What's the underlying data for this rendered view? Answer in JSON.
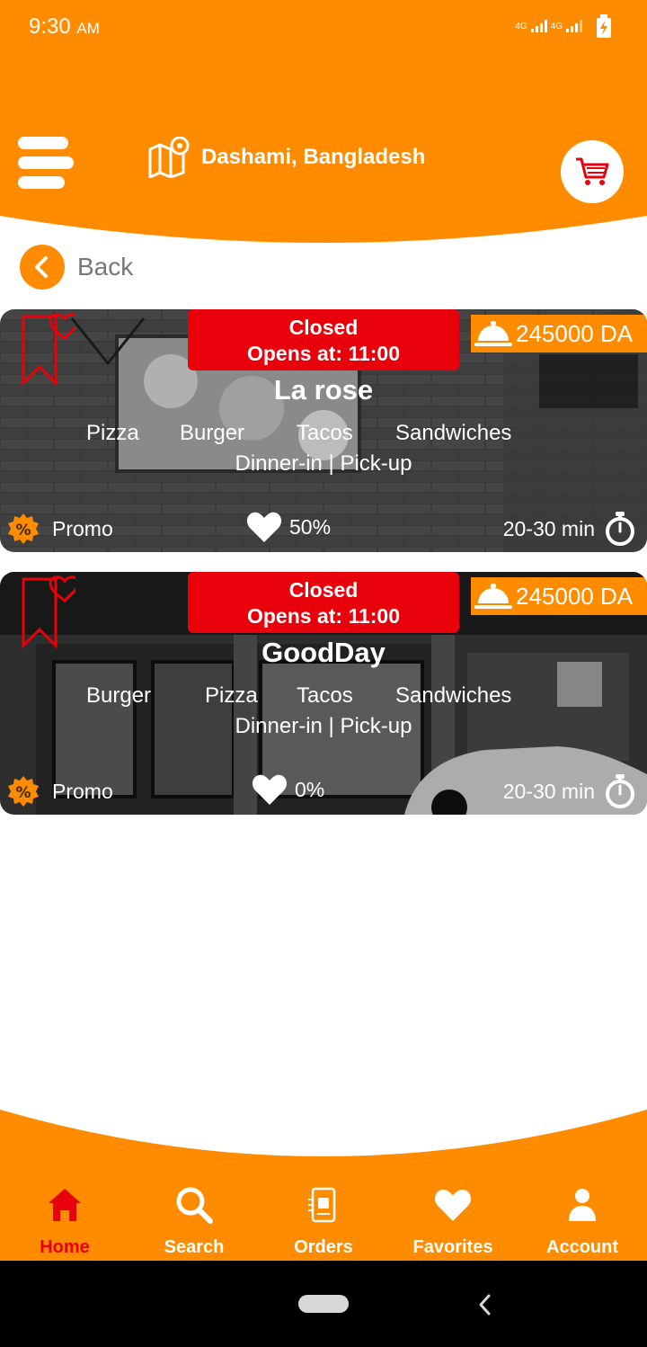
{
  "status_bar": {
    "time": "9:30",
    "ampm": "AM",
    "net1": "4G",
    "net2": "4G"
  },
  "header": {
    "location": "Dashami, Bangladesh"
  },
  "back": {
    "label": "Back"
  },
  "restaurants": [
    {
      "closed_label": "Closed",
      "opens_label": "Opens at: 11:00",
      "fee": "245000 DA",
      "name": "La rose",
      "cuisines": [
        "Pizza",
        "Burger",
        "Tacos",
        "Sandwiches"
      ],
      "service": "Dinner-in | Pick-up",
      "promo": "Promo",
      "likes": "50%",
      "time": "20-30 min"
    },
    {
      "closed_label": "Closed",
      "opens_label": "Opens at: 11:00",
      "fee": "245000 DA",
      "name": "GoodDay",
      "cuisines": [
        "Burger",
        "Pizza",
        "Tacos",
        "Sandwiches"
      ],
      "service": "Dinner-in | Pick-up",
      "promo": "Promo",
      "likes": "0%",
      "time": "20-30 min"
    }
  ],
  "nav": {
    "home": "Home",
    "search": "Search",
    "orders": "Orders",
    "favorites": "Favorites",
    "account": "Account"
  },
  "colors": {
    "brand": "#FF8C00",
    "accent": "#E8000B"
  }
}
